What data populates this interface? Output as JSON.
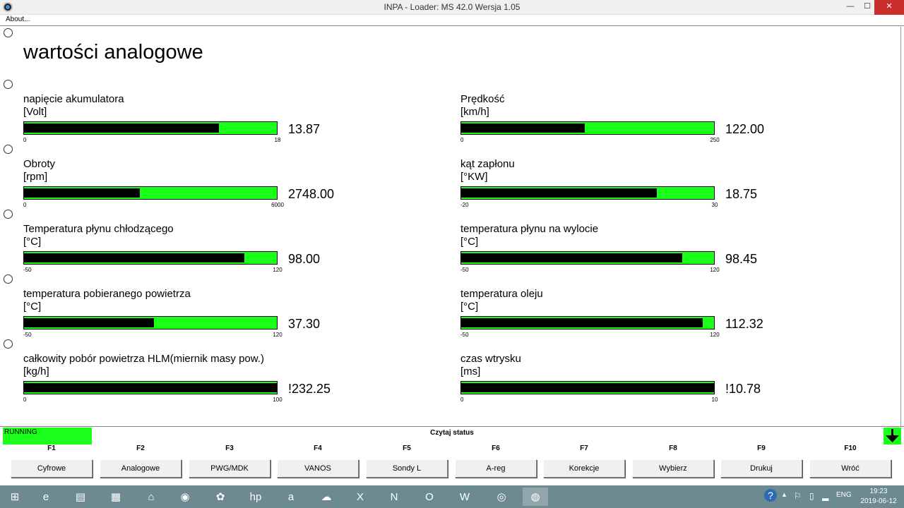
{
  "window": {
    "title": "INPA - Loader:  MS 42.0 Wersja 1.05",
    "min_glyph": "—",
    "max_glyph": "☐",
    "close_glyph": "✕"
  },
  "menu": {
    "about": "About..."
  },
  "page": {
    "title": "wartości analogowe"
  },
  "gauges": [
    {
      "label": "napięcie akumulatora",
      "unit": "[Volt]",
      "value": "13.87",
      "min": "0",
      "max": "18",
      "fill": 0.77
    },
    {
      "label": "Prędkość",
      "unit": "[km/h]",
      "value": "122.00",
      "min": "0",
      "max": "250",
      "fill": 0.488
    },
    {
      "label": "Obroty",
      "unit": "[rpm]",
      "value": "2748.00",
      "min": "0",
      "max": "6000",
      "fill": 0.458
    },
    {
      "label": "kąt zapłonu",
      "unit": "[°KW]",
      "value": "18.75",
      "min": "-20",
      "max": "30",
      "fill": 0.775
    },
    {
      "label": "Temperatura płynu chłodzącego",
      "unit": "[°C]",
      "value": "98.00",
      "min": "-50",
      "max": "120",
      "fill": 0.871
    },
    {
      "label": "temperatura płynu na wylocie",
      "unit": "[°C]",
      "value": "98.45",
      "min": "-50",
      "max": "120",
      "fill": 0.873
    },
    {
      "label": "temperatura pobieranego powietrza",
      "unit": "[°C]",
      "value": "37.30",
      "min": "-50",
      "max": "120",
      "fill": 0.514
    },
    {
      "label": "temperatura oleju",
      "unit": "[°C]",
      "value": "112.32",
      "min": "-50",
      "max": "120",
      "fill": 0.955
    },
    {
      "label": "całkowity pobór powietrza HLM(miernik masy pow.)",
      "unit": "[kg/h]",
      "value": "!232.25",
      "min": "0",
      "max": "100",
      "fill": 1.0
    },
    {
      "label": "czas wtrysku",
      "unit": "[ms]",
      "value": "!10.78",
      "min": "0",
      "max": "10",
      "fill": 1.0
    }
  ],
  "status": {
    "running": "RUNNING",
    "text": "Czytaj status"
  },
  "fkeys": [
    {
      "key": "F1",
      "label": "Cyfrowe"
    },
    {
      "key": "F2",
      "label": "Analogowe"
    },
    {
      "key": "F3",
      "label": "PWG/MDK"
    },
    {
      "key": "F4",
      "label": "VANOS"
    },
    {
      "key": "F5",
      "label": "Sondy L"
    },
    {
      "key": "F6",
      "label": "A-reg"
    },
    {
      "key": "F7",
      "label": "Korekcje"
    },
    {
      "key": "F8",
      "label": "Wybierz"
    },
    {
      "key": "F9",
      "label": "Drukuj"
    },
    {
      "key": "F10",
      "label": "Wróć"
    }
  ],
  "taskbar": {
    "icons": [
      {
        "name": "windows-start-icon",
        "glyph": "⊞"
      },
      {
        "name": "internet-explorer-icon",
        "glyph": "e"
      },
      {
        "name": "file-explorer-icon",
        "glyph": "▤"
      },
      {
        "name": "store-icon",
        "glyph": "▦"
      },
      {
        "name": "home-icon",
        "glyph": "⌂"
      },
      {
        "name": "media-icon",
        "glyph": "◉"
      },
      {
        "name": "app-icon",
        "glyph": "✿"
      },
      {
        "name": "hp-icon",
        "glyph": "hp"
      },
      {
        "name": "amazon-icon",
        "glyph": "a"
      },
      {
        "name": "onedrive-icon",
        "glyph": "☁"
      },
      {
        "name": "excel-icon",
        "glyph": "X"
      },
      {
        "name": "onenote-icon",
        "glyph": "N"
      },
      {
        "name": "outlook-icon",
        "glyph": "O"
      },
      {
        "name": "word-icon",
        "glyph": "W"
      },
      {
        "name": "chrome-icon",
        "glyph": "◎"
      },
      {
        "name": "bmw-icon",
        "glyph": "◍"
      }
    ],
    "lang": "ENG",
    "time": "19:23",
    "date": "2019-06-12",
    "help_glyph": "?",
    "arrow_glyph": "▲"
  }
}
